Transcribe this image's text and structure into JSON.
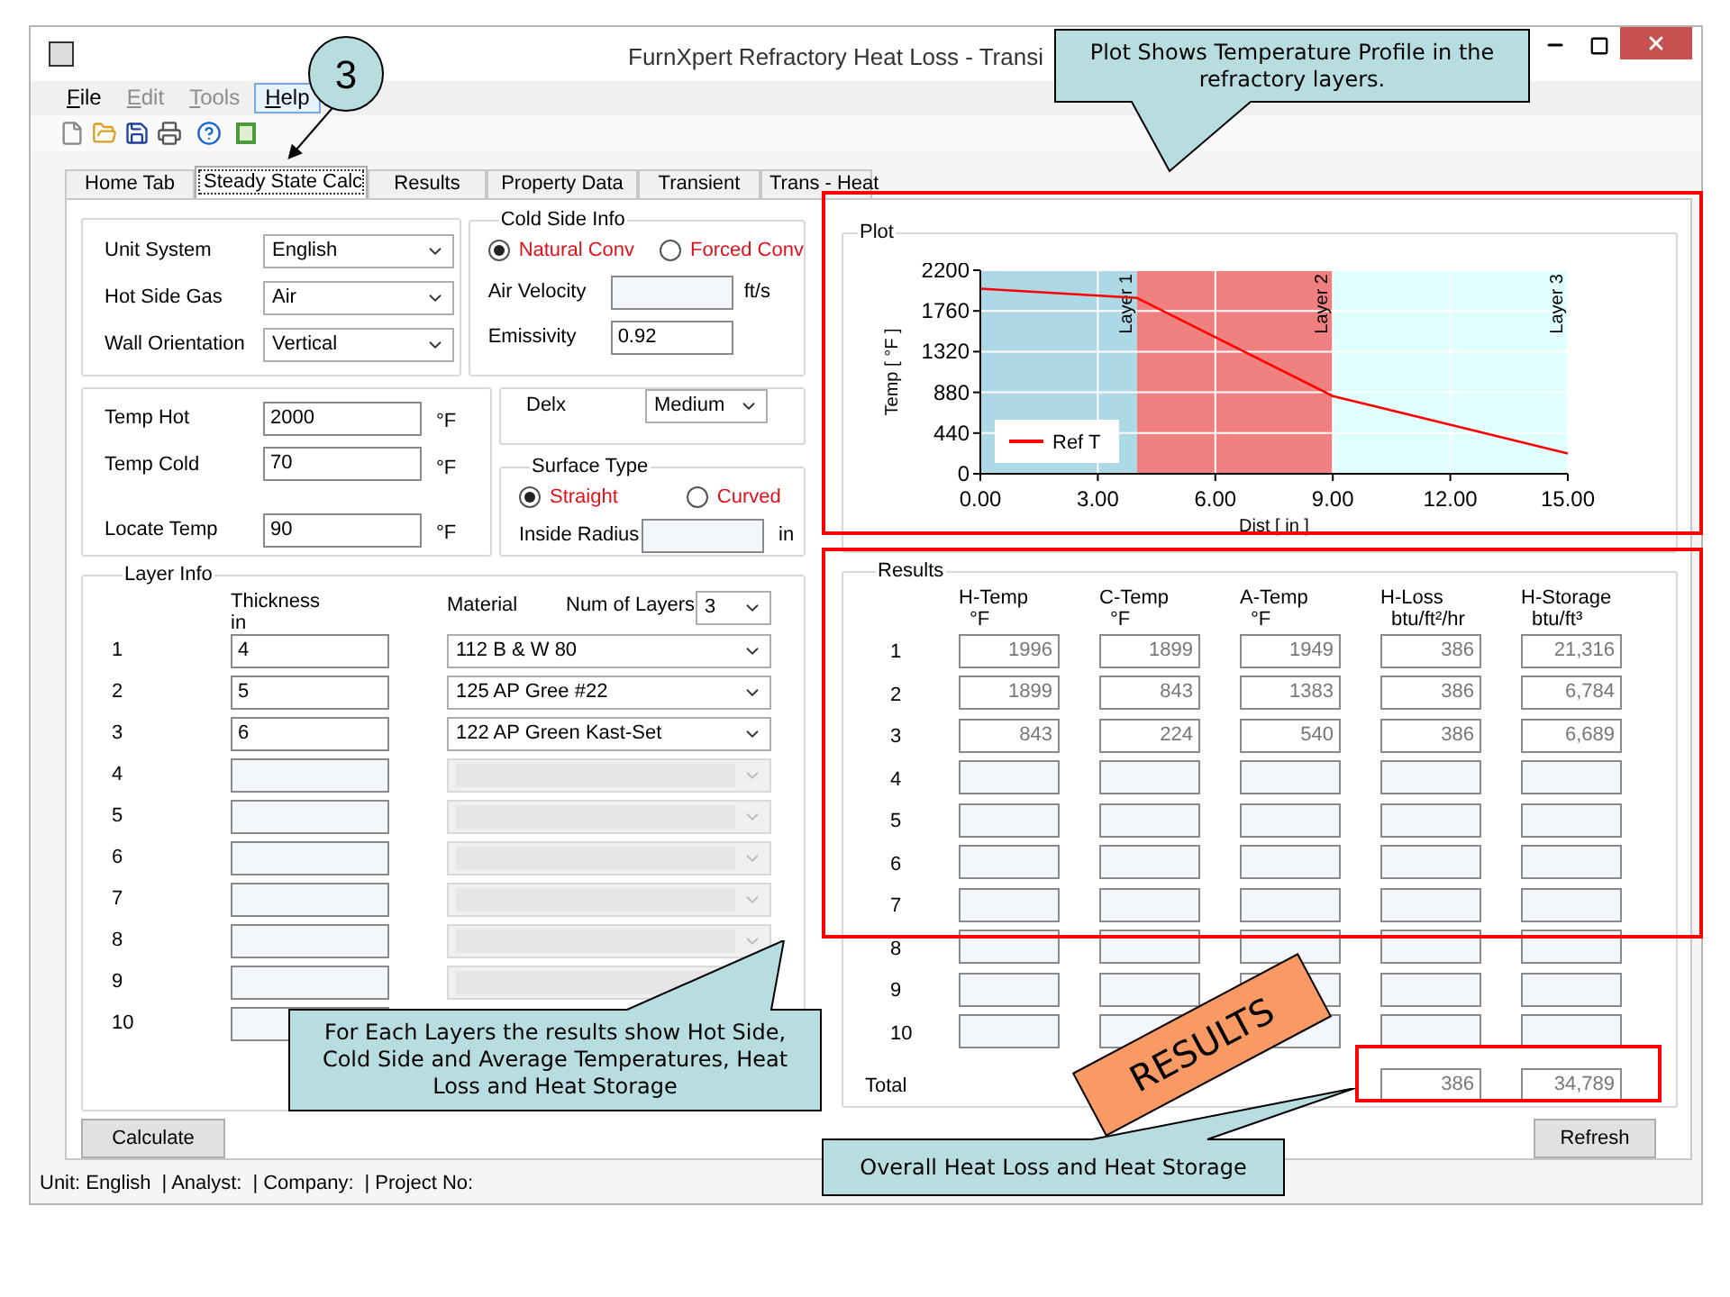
{
  "window": {
    "title": "FurnXpert Refractory Heat Loss - Transi"
  },
  "menu": [
    {
      "label": "File",
      "disabled": false,
      "selected": false
    },
    {
      "label": "Edit",
      "disabled": true,
      "selected": false
    },
    {
      "label": "Tools",
      "disabled": true,
      "selected": false
    },
    {
      "label": "Help",
      "disabled": false,
      "selected": true
    }
  ],
  "tabs": [
    {
      "label": "Home Tab",
      "selected": false
    },
    {
      "label": "Steady State Calc",
      "selected": true
    },
    {
      "label": "Results",
      "selected": false
    },
    {
      "label": "Property Data",
      "selected": false
    },
    {
      "label": "Transient",
      "selected": false
    },
    {
      "label": "Trans - Heat",
      "selected": false
    }
  ],
  "general": [
    {
      "label": "Unit System",
      "value": "English"
    },
    {
      "label": "Hot Side Gas",
      "value": "Air"
    },
    {
      "label": "Wall Orientation",
      "value": "Vertical"
    }
  ],
  "cold_side": {
    "title": "Cold Side Info",
    "options": [
      {
        "label": "Natural Conv",
        "selected": true
      },
      {
        "label": "Forced Conv",
        "selected": false
      }
    ],
    "air_velocity": {
      "label": "Air Velocity",
      "unit": "ft/s"
    },
    "emissivity": {
      "label": "Emissivity",
      "value": "0.92"
    }
  },
  "temperatures": [
    {
      "label": "Temp Hot",
      "value": "2000",
      "unit": "°F"
    },
    {
      "label": "Temp Cold",
      "value": "70",
      "unit": "°F"
    },
    {
      "label": "Locate Temp",
      "value": "90",
      "unit": "°F"
    }
  ],
  "delx": {
    "label": "Delx",
    "value": "Medium"
  },
  "surface_type": {
    "title": "Surface Type",
    "options": [
      {
        "label": "Straight",
        "selected": true
      },
      {
        "label": "Curved",
        "selected": false
      }
    ],
    "inside_radius": {
      "label": "Inside Radius",
      "unit": "in"
    }
  },
  "layer_info": {
    "title": "Layer Info",
    "thickness_header": "Thickness",
    "thickness_unit": "in",
    "material_header": "Material",
    "num_layers_label": "Num of Layers",
    "num_layers": "3",
    "rows": [
      {
        "number": "1",
        "thickness": "4",
        "material": "112 B & W 80",
        "disabled": false
      },
      {
        "number": "2",
        "thickness": "5",
        "material": "125 AP Gree #22",
        "disabled": false
      },
      {
        "number": "3",
        "thickness": "6",
        "material": "122 AP Green Kast-Set",
        "disabled": false
      },
      {
        "number": "4",
        "disabled": true
      },
      {
        "number": "5",
        "disabled": true
      },
      {
        "number": "6",
        "disabled": true
      },
      {
        "number": "7",
        "disabled": true
      },
      {
        "number": "8",
        "disabled": true
      },
      {
        "number": "9",
        "disabled": true
      },
      {
        "number": "10"
      }
    ]
  },
  "calculate_button": "Calculate",
  "plot": {
    "title": "Plot",
    "chart_data": {
      "type": "line",
      "xlabel": "Dist [ in ]",
      "ylabel": "Temp [ °F ]",
      "x": [
        0,
        4,
        9,
        15
      ],
      "series": [
        {
          "name": "Ref T",
          "color": "#ff0000",
          "values": [
            2000,
            1900,
            840,
            220
          ]
        }
      ],
      "xlim": [
        0,
        15
      ],
      "ylim": [
        0,
        2200
      ],
      "xticks": [
        {
          "value": 0,
          "label": "0.00"
        },
        {
          "value": 3,
          "label": "3.00"
        },
        {
          "value": 6,
          "label": "6.00"
        },
        {
          "value": 9,
          "label": "9.00"
        },
        {
          "value": 12,
          "label": "12.00"
        },
        {
          "value": 15,
          "label": "15.00"
        }
      ],
      "yticks": [
        0,
        440,
        880,
        1320,
        1760,
        2200
      ],
      "grid": true,
      "bands": [
        {
          "axis": "x",
          "from": 0,
          "to": 4,
          "color": "#add8e6",
          "label": "Layer 1"
        },
        {
          "axis": "x",
          "from": 4,
          "to": 9,
          "color": "#f08080",
          "label": "Layer 2"
        },
        {
          "axis": "x",
          "from": 9,
          "to": 15,
          "color": "#e0ffff",
          "label": "Layer 3"
        }
      ]
    }
  },
  "results": {
    "title": "Results",
    "columns": [
      {
        "name": "H-Temp",
        "unit": "°F"
      },
      {
        "name": "C-Temp",
        "unit": "°F"
      },
      {
        "name": "A-Temp",
        "unit": "°F"
      },
      {
        "name": "H-Loss",
        "unit": "btu/ft²/hr"
      },
      {
        "name": "H-Storage",
        "unit": "btu/ft³"
      }
    ],
    "rows": [
      {
        "number": "1",
        "values": [
          "1996",
          "1899",
          "1949",
          "386",
          "21,316"
        ]
      },
      {
        "number": "2",
        "values": [
          "1899",
          "843",
          "1383",
          "386",
          "6,784"
        ]
      },
      {
        "number": "3",
        "values": [
          "843",
          "224",
          "540",
          "386",
          "6,689"
        ]
      },
      {
        "number": "4"
      },
      {
        "number": "5"
      },
      {
        "number": "6"
      },
      {
        "number": "7"
      },
      {
        "number": "8"
      },
      {
        "number": "9"
      },
      {
        "number": "10"
      }
    ],
    "total": {
      "label": "Total",
      "heat_loss": "386",
      "heat_storage": "34,789"
    }
  },
  "refresh_button": "Refresh",
  "status_bar": [
    "Unit: English",
    "| Analyst:",
    "| Company:",
    "| Project No:"
  ],
  "annotations": {
    "step": "3",
    "sticker": "RESULTS",
    "callouts": [
      "Plot Shows Temperature  Profile in the refractory  layers.",
      "For Each Layers the results show Hot Side, Cold Side and Average  Temperatures, Heat Loss and Heat Storage",
      "Overall  Heat Loss and Heat Storage"
    ]
  }
}
